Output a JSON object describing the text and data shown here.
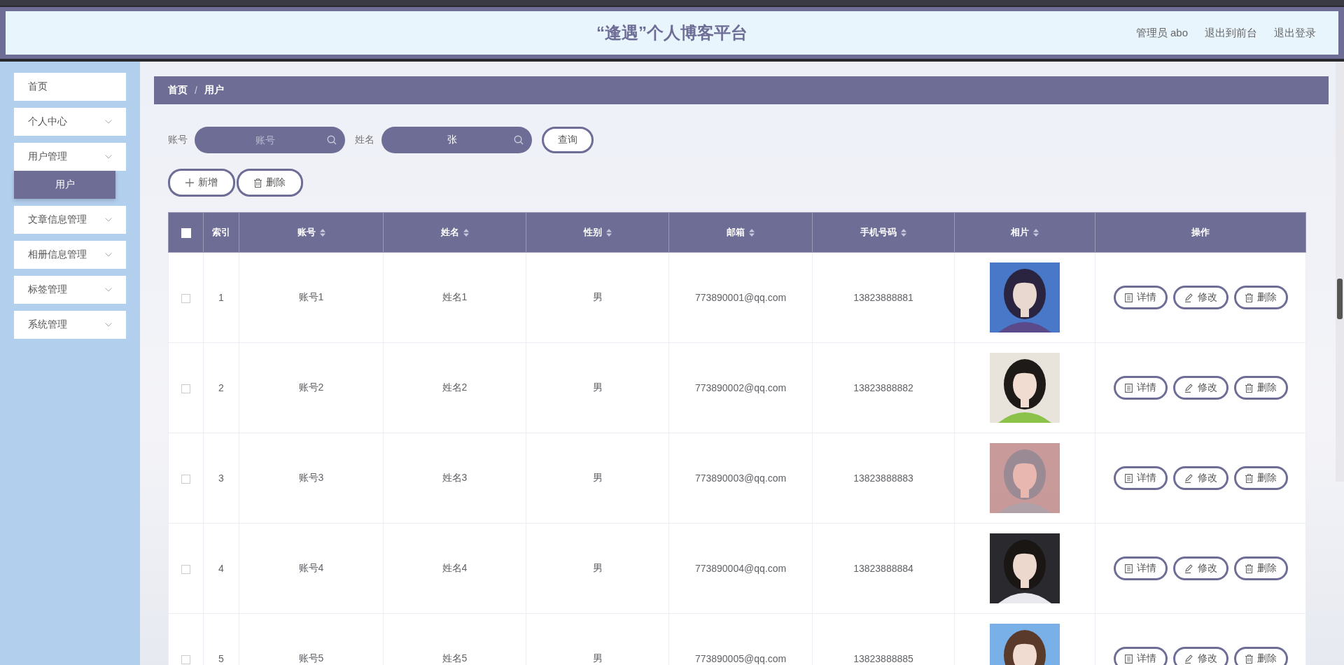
{
  "header": {
    "title": "“逢遇”个人博客平台",
    "links": [
      "管理员 abo",
      "退出到前台",
      "退出登录"
    ]
  },
  "sidebar": {
    "items": [
      {
        "label": "首页",
        "expandable": false
      },
      {
        "label": "个人中心",
        "expandable": true
      },
      {
        "label": "用户管理",
        "expandable": true,
        "expanded": true,
        "children": [
          {
            "label": "用户",
            "selected": true
          }
        ]
      },
      {
        "label": "文章信息管理",
        "expandable": true
      },
      {
        "label": "相册信息管理",
        "expandable": true
      },
      {
        "label": "标签管理",
        "expandable": true
      },
      {
        "label": "系统管理",
        "expandable": true
      }
    ]
  },
  "breadcrumb": [
    "首页",
    "/",
    "用户"
  ],
  "search": {
    "fields": [
      {
        "label": "账号",
        "placeholder": "账号"
      },
      {
        "label": "姓名",
        "value": "张"
      }
    ],
    "button": "查询"
  },
  "actions": [
    {
      "kind": "add",
      "label": "新增"
    },
    {
      "kind": "delete",
      "label": "删除"
    }
  ],
  "table": {
    "select_all_checked": false,
    "columns": [
      {
        "label": "索引",
        "sortable": false
      },
      {
        "label": "账号",
        "sortable": true
      },
      {
        "label": "姓名",
        "sortable": true
      },
      {
        "label": "性别",
        "sortable": true
      },
      {
        "label": "邮箱",
        "sortable": true
      },
      {
        "label": "手机号码",
        "sortable": true
      },
      {
        "label": "相片",
        "sortable": true
      },
      {
        "label": "操作",
        "sortable": false
      }
    ],
    "rows": [
      {
        "checked": false,
        "index": "1",
        "account": "账号1",
        "name": "姓名1",
        "gender": "男",
        "email": "773890001@qq.com",
        "phone": "13823888881",
        "actions": [
          {
            "kind": "detail",
            "label": "详情"
          },
          {
            "kind": "edit",
            "label": "修改"
          },
          {
            "kind": "delete",
            "label": "删除"
          }
        ]
      },
      {
        "checked": false,
        "index": "2",
        "account": "账号2",
        "name": "姓名2",
        "gender": "男",
        "email": "773890002@qq.com",
        "phone": "13823888882",
        "actions": [
          {
            "kind": "detail",
            "label": "详情"
          },
          {
            "kind": "edit",
            "label": "修改"
          },
          {
            "kind": "delete",
            "label": "删除"
          }
        ]
      },
      {
        "checked": false,
        "index": "3",
        "account": "账号3",
        "name": "姓名3",
        "gender": "男",
        "email": "773890003@qq.com",
        "phone": "13823888883",
        "actions": [
          {
            "kind": "detail",
            "label": "详情"
          },
          {
            "kind": "edit",
            "label": "修改"
          },
          {
            "kind": "delete",
            "label": "删除"
          }
        ]
      },
      {
        "checked": false,
        "index": "4",
        "account": "账号4",
        "name": "姓名4",
        "gender": "男",
        "email": "773890004@qq.com",
        "phone": "13823888884",
        "actions": [
          {
            "kind": "detail",
            "label": "详情"
          },
          {
            "kind": "edit",
            "label": "修改"
          },
          {
            "kind": "delete",
            "label": "删除"
          }
        ]
      },
      {
        "checked": false,
        "index": "5",
        "account": "账号5",
        "name": "姓名5",
        "gender": "男",
        "email": "773890005@qq.com",
        "phone": "13823888885",
        "actions": [
          {
            "kind": "detail",
            "label": "详情"
          },
          {
            "kind": "edit",
            "label": "修改"
          },
          {
            "kind": "delete",
            "label": "删除"
          }
        ]
      }
    ]
  }
}
